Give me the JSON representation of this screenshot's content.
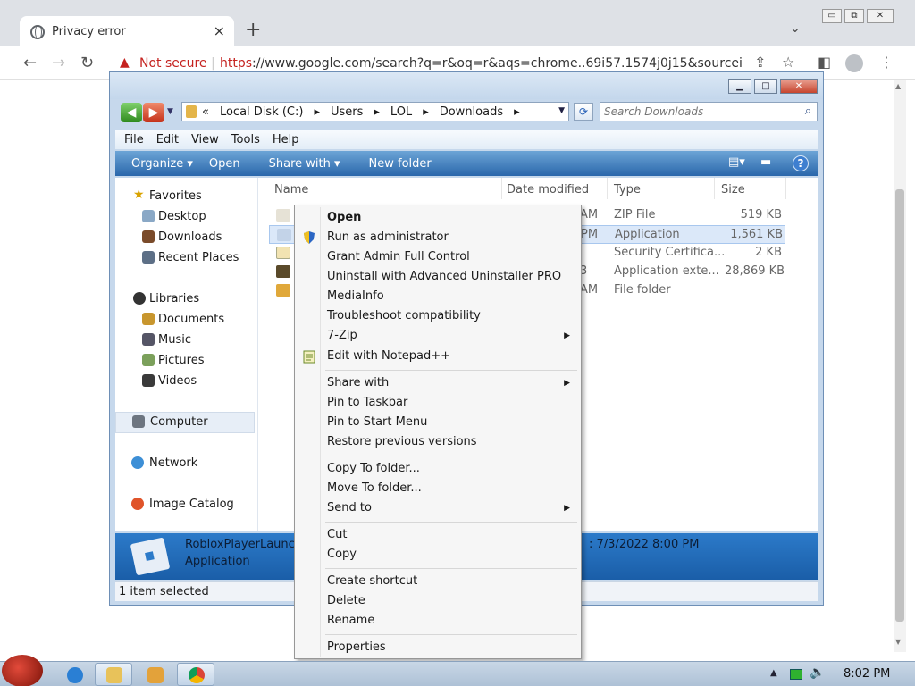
{
  "chrome": {
    "tab_title": "Privacy error",
    "new_tab": "+",
    "tab_close": "×",
    "tab_search": "⌄",
    "security_label": "Not secure",
    "url_scheme": "https",
    "url_rest": "://www.google.com/search?q=r&oq=r&aqs=chrome..69i57.1574j0j15&sourceid...",
    "window_buttons": [
      "▭",
      "⧉",
      "✕"
    ]
  },
  "explorer": {
    "breadcrumb_prefix": "«",
    "breadcrumbs": [
      "Local Disk (C:)",
      "Users",
      "LOL",
      "Downloads"
    ],
    "search_placeholder": "Search Downloads",
    "menu": [
      "File",
      "Edit",
      "View",
      "Tools",
      "Help"
    ],
    "commands": {
      "organize": "Organize ▾",
      "open": "Open",
      "share_with": "Share with ▾",
      "new_folder": "New folder"
    },
    "nav": {
      "favorites": "Favorites",
      "desktop": "Desktop",
      "downloads": "Downloads",
      "recent_places": "Recent Places",
      "libraries": "Libraries",
      "documents": "Documents",
      "music": "Music",
      "pictures": "Pictures",
      "videos": "Videos",
      "computer": "Computer",
      "network": "Network",
      "image_catalog": "Image Catalog"
    },
    "columns": {
      "name": "Name",
      "date": "Date modified",
      "type": "Type",
      "size": "Size"
    },
    "files": [
      {
        "time": "AM",
        "type": "ZIP File",
        "size": "519 KB"
      },
      {
        "time": "PM",
        "type": "Application",
        "size": "1,561 KB"
      },
      {
        "time": "",
        "type": "Security Certifica...",
        "size": "2 KB"
      },
      {
        "time": "3",
        "type": "Application exte...",
        "size": "28,869 KB"
      },
      {
        "time": "AM",
        "type": "File folder",
        "size": ""
      }
    ],
    "details": {
      "name": "RobloxPlayerLaunch",
      "type": "Application",
      "date": ": 7/3/2022 8:00 PM"
    },
    "status": "1 item selected"
  },
  "context_menu": {
    "open": "Open",
    "run_as_admin": "Run as administrator",
    "grant_admin": "Grant Admin Full Control",
    "uninstall": "Uninstall with Advanced Uninstaller PRO",
    "mediainfo": "MediaInfo",
    "troubleshoot": "Troubleshoot compatibility",
    "seven_zip": "7-Zip",
    "notepad": "Edit with Notepad++",
    "share_with": "Share with",
    "pin_taskbar": "Pin to Taskbar",
    "pin_start": "Pin to Start Menu",
    "restore": "Restore previous versions",
    "copy_to": "Copy To folder...",
    "move_to": "Move To folder...",
    "send_to": "Send to",
    "cut": "Cut",
    "copy": "Copy",
    "create_shortcut": "Create shortcut",
    "delete": "Delete",
    "rename": "Rename",
    "properties": "Properties"
  },
  "taskbar": {
    "clock": "8:02 PM"
  }
}
